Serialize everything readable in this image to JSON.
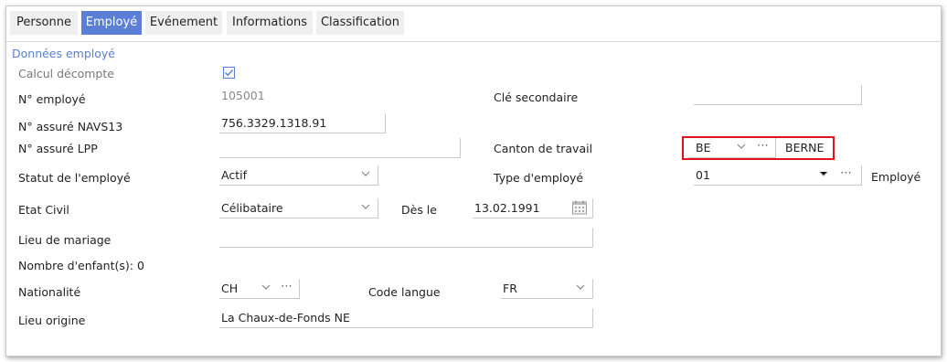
{
  "tabs": [
    "Personne",
    "Employé",
    "Evénement",
    "Informations",
    "Classification"
  ],
  "section_title": "Données employé",
  "fields": {
    "calcul_decompte": {
      "label": "Calcul décompte",
      "checked": true
    },
    "numero_employe": {
      "label": "N° employé",
      "value": "105001"
    },
    "cle_secondaire": {
      "label": "Clé secondaire",
      "value": ""
    },
    "navs13": {
      "label": "N° assuré NAVS13",
      "value": "756.3329.1318.91"
    },
    "lpp": {
      "label": "N° assuré LPP",
      "value": ""
    },
    "canton": {
      "label": "Canton de travail",
      "code": "BE",
      "name": "BERNE"
    },
    "statut": {
      "label": "Statut de l'employé",
      "value": "Actif"
    },
    "type_employe": {
      "label": "Type d'employé",
      "code": "01",
      "name": "Employé"
    },
    "etat_civil": {
      "label": "Etat Civil",
      "value": "Célibataire"
    },
    "des_le": {
      "label": "Dès le",
      "value": "13.02.1991"
    },
    "lieu_mariage": {
      "label": "Lieu de mariage",
      "value": ""
    },
    "enfants": {
      "label": "Nombre d'enfant(s): 0"
    },
    "nationalite": {
      "label": "Nationalité",
      "value": "CH"
    },
    "code_langue": {
      "label": "Code langue",
      "value": "FR"
    },
    "lieu_origine": {
      "label": "Lieu origine",
      "value": "La Chaux-de-Fonds NE"
    }
  },
  "colors": {
    "accent": "#5b7fd6",
    "highlight": "#e0141e"
  }
}
